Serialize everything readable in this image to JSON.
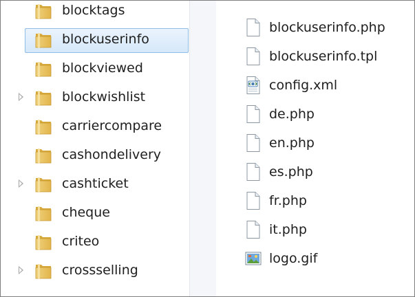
{
  "navigation": {
    "folders": [
      {
        "label": "blocktags",
        "selected": false,
        "has_children": false,
        "icon": "folder-icon"
      },
      {
        "label": "blockuserinfo",
        "selected": true,
        "has_children": false,
        "icon": "folder-icon"
      },
      {
        "label": "blockviewed",
        "selected": false,
        "has_children": false,
        "icon": "folder-icon"
      },
      {
        "label": "blockwishlist",
        "selected": false,
        "has_children": true,
        "icon": "folder-icon"
      },
      {
        "label": "carriercompare",
        "selected": false,
        "has_children": false,
        "icon": "folder-icon"
      },
      {
        "label": "cashondelivery",
        "selected": false,
        "has_children": false,
        "icon": "folder-icon"
      },
      {
        "label": "cashticket",
        "selected": false,
        "has_children": true,
        "icon": "folder-icon"
      },
      {
        "label": "cheque",
        "selected": false,
        "has_children": false,
        "icon": "folder-icon"
      },
      {
        "label": "criteo",
        "selected": false,
        "has_children": false,
        "icon": "folder-icon"
      },
      {
        "label": "crossselling",
        "selected": false,
        "has_children": true,
        "icon": "folder-icon"
      }
    ]
  },
  "files": [
    {
      "label": "blockuserinfo.php",
      "icon": "document-icon"
    },
    {
      "label": "blockuserinfo.tpl",
      "icon": "document-icon"
    },
    {
      "label": "config.xml",
      "icon": "xml-file-icon"
    },
    {
      "label": "de.php",
      "icon": "document-icon"
    },
    {
      "label": "en.php",
      "icon": "document-icon"
    },
    {
      "label": "es.php",
      "icon": "document-icon"
    },
    {
      "label": "fr.php",
      "icon": "document-icon"
    },
    {
      "label": "it.php",
      "icon": "document-icon"
    },
    {
      "label": "logo.gif",
      "icon": "image-file-icon"
    }
  ],
  "colors": {
    "selection_fill": "#d6e8fa",
    "selection_border": "#8fbde9",
    "folder": "#e8c45c",
    "divider_pane": "#f4f6f9"
  }
}
